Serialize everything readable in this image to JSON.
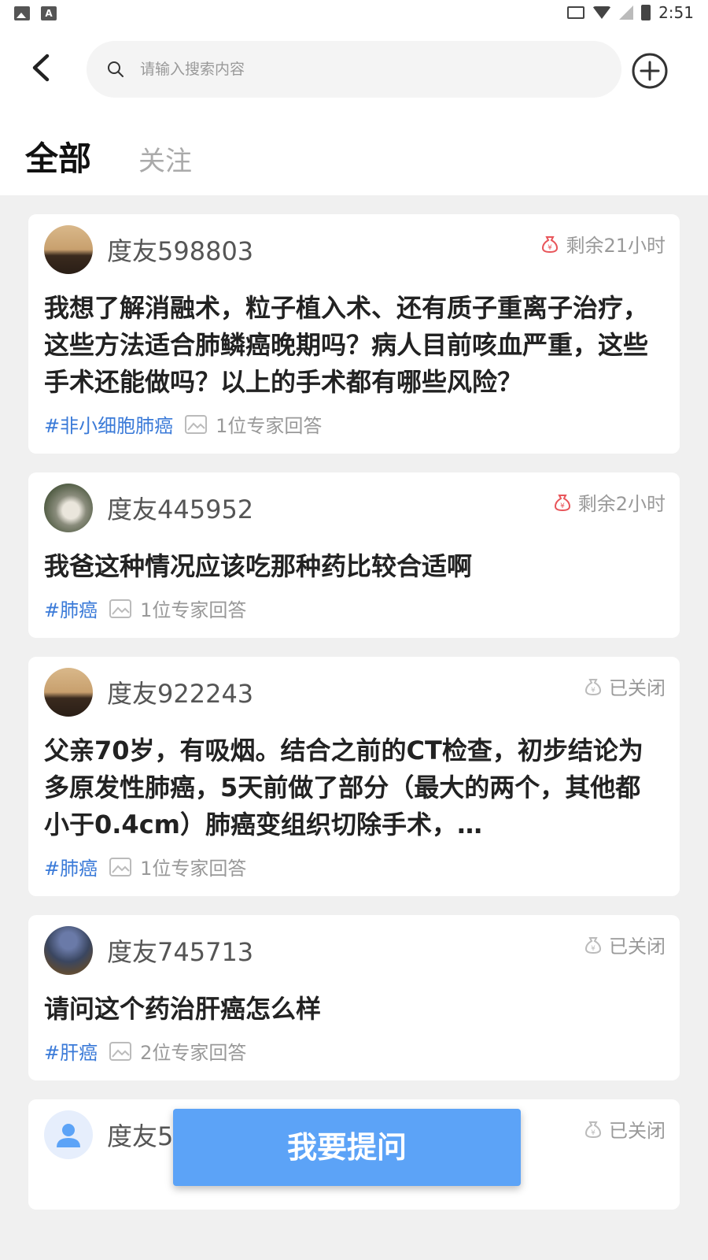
{
  "statusbar": {
    "time": "2:51"
  },
  "search": {
    "placeholder": "请输入搜索内容"
  },
  "tabs": {
    "all": "全部",
    "following": "关注"
  },
  "posts": [
    {
      "user": "度友598803",
      "status": "剩余21小时",
      "status_type": "remaining",
      "question": "我想了解消融术，粒子植入术、还有质子重离子治疗，这些方法适合肺鳞癌晚期吗？病人目前咳血严重，这些手术还能做吗？以上的手术都有哪些风险？",
      "tag": "#非小细胞肺癌",
      "answers": "1位专家回答"
    },
    {
      "user": "度友445952",
      "status": "剩余2小时",
      "status_type": "remaining",
      "question": "我爸这种情况应该吃那种药比较合适啊",
      "tag": "#肺癌",
      "answers": "1位专家回答"
    },
    {
      "user": "度友922243",
      "status": "已关闭",
      "status_type": "closed",
      "question": "父亲70岁，有吸烟。结合之前的CT检查，初步结论为多原发性肺癌，5天前做了部分（最大的两个，其他都小于0.4cm）肺癌变组织切除手术，…",
      "tag": "#肺癌",
      "answers": "1位专家回答"
    },
    {
      "user": "度友745713",
      "status": "已关闭",
      "status_type": "closed",
      "question": "请问这个药治肝癌怎么样",
      "tag": "#肝癌",
      "answers": "2位专家回答"
    },
    {
      "user": "度友514139",
      "status": "已关闭",
      "status_type": "closed"
    }
  ],
  "ask_button": "我要提问",
  "colors": {
    "accent": "#5ca3f7",
    "tag": "#3a7ad8",
    "remaining": "#e8555a",
    "closed": "#bbbbbb"
  }
}
